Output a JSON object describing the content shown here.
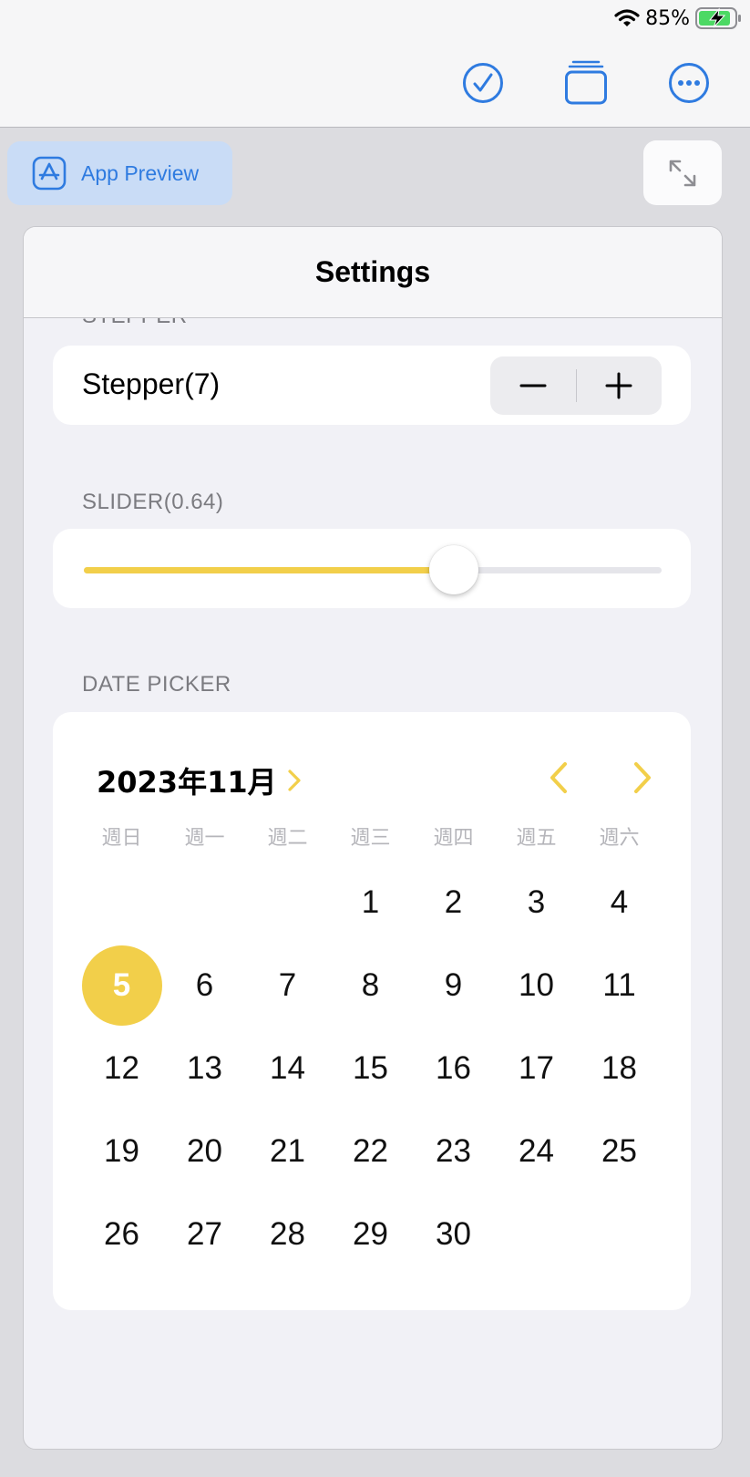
{
  "status": {
    "battery_text": "85%"
  },
  "toolbar": {
    "done_icon": "checkmark-circle-icon",
    "tabs_icon": "stacked-windows-icon",
    "more_icon": "ellipsis-circle-icon"
  },
  "preview_chip": {
    "label": "App Preview",
    "icon": "app-store-icon"
  },
  "expand": {
    "icon": "expand-arrows-icon"
  },
  "sheet": {
    "title": "Settings",
    "stepper": {
      "section": "STEPPER",
      "label": "Stepper(7)",
      "minus": "−",
      "plus": "+"
    },
    "slider": {
      "section": "SLIDER(0.64)",
      "value": 0.64
    },
    "date_picker": {
      "section": "DATE PICKER",
      "month_label": "2023年11月",
      "weekdays": [
        "週日",
        "週一",
        "週二",
        "週三",
        "週四",
        "週五",
        "週六"
      ],
      "weeks": [
        [
          "",
          "",
          "",
          "1",
          "2",
          "3",
          "4"
        ],
        [
          "5",
          "6",
          "7",
          "8",
          "9",
          "10",
          "11"
        ],
        [
          "12",
          "13",
          "14",
          "15",
          "16",
          "17",
          "18"
        ],
        [
          "19",
          "20",
          "21",
          "22",
          "23",
          "24",
          "25"
        ],
        [
          "26",
          "27",
          "28",
          "29",
          "30",
          "",
          ""
        ]
      ],
      "selected_day": "5"
    }
  },
  "colors": {
    "accent_yellow": "#f2cf4a",
    "tint_blue": "#2f7be0"
  }
}
